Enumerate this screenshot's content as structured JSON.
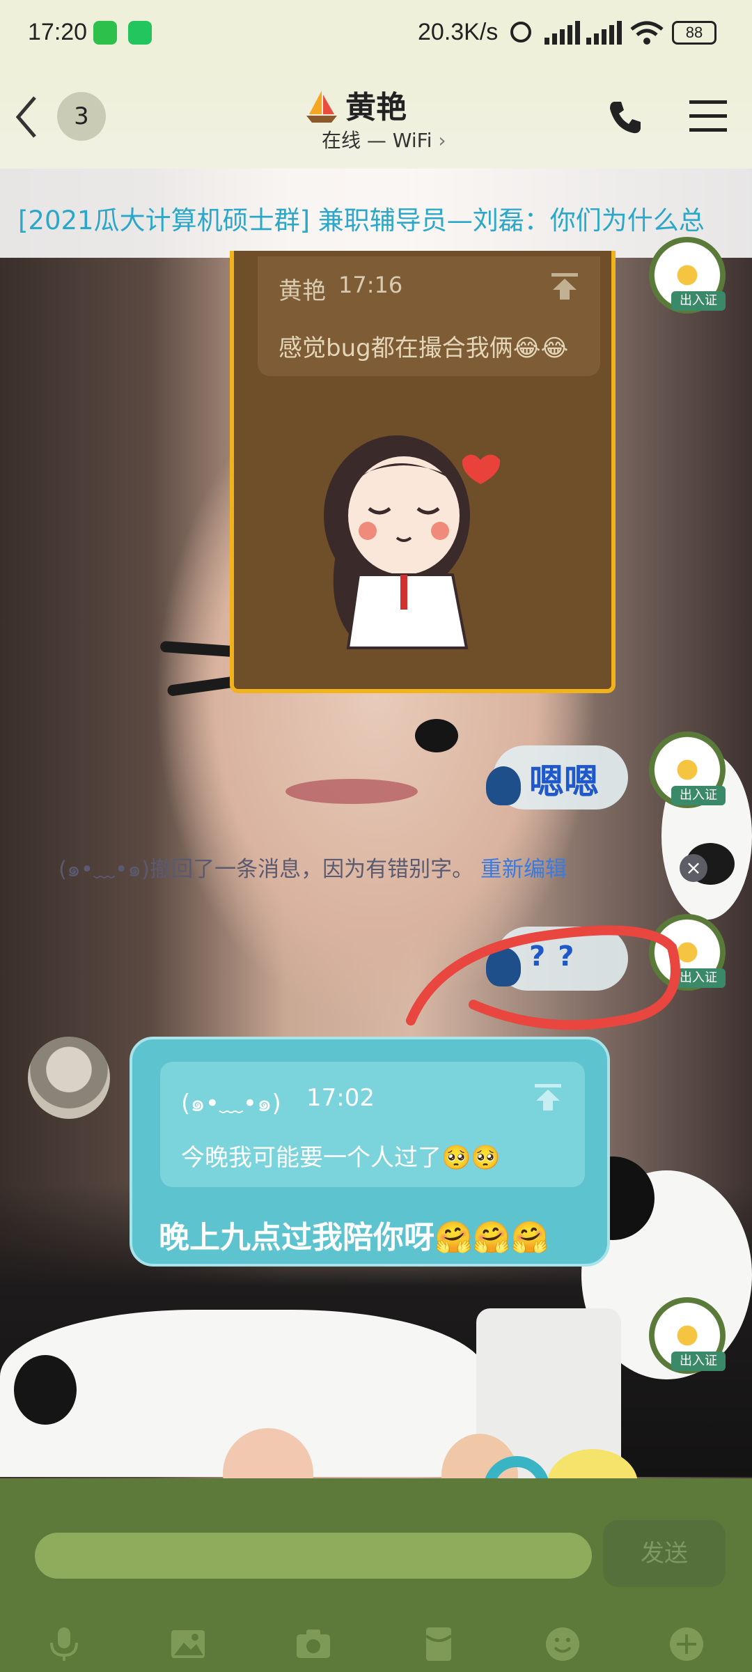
{
  "status_bar": {
    "time": "17:20",
    "net_speed": "20.3K/s",
    "battery": "88"
  },
  "header": {
    "back_label": "<",
    "unread_count": "3",
    "contact_name": "黄艳",
    "status": "在线 — WiFi"
  },
  "banner": {
    "text": "[2021瓜大计算机硕士群] 兼职辅导员—刘磊：你们为什么总"
  },
  "messages": {
    "quoted_card": {
      "author": "黄艳",
      "time": "17:16",
      "text": "感觉bug都在撮合我俩😂😂"
    },
    "bubble_enen": "嗯嗯",
    "recall_notice": "(๑•﹏•๑)撤回了一条消息，因为有错别字。",
    "reedit_link": "重新编辑",
    "bubble_qq": "??",
    "reply_card": {
      "quote_author": "(๑•﹏•๑)",
      "quote_time": "17:02",
      "quote_text": "今晚我可能要一个人过了🥺🥺",
      "reply_text": "晚上九点过我陪你呀🤗🤗🤗"
    },
    "badge_label": "出入证"
  },
  "composer": {
    "input_value": "",
    "send_label": "发送"
  },
  "colors": {
    "accent_teal": "#5dc3cf",
    "card_brown": "#6f4e2a",
    "card_border": "#f2b21b",
    "composer_green": "#5d7a3a",
    "input_green": "#8fab5c",
    "annotation_red": "#e8463f"
  }
}
